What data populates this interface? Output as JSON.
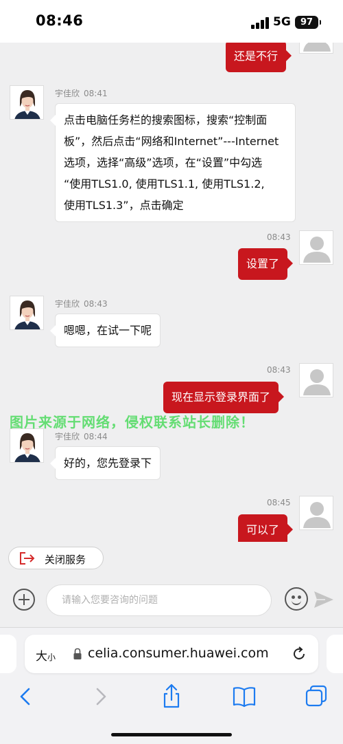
{
  "status_bar": {
    "time": "08:46",
    "network": "5G",
    "battery": "97"
  },
  "messages": [
    {
      "direction": "out",
      "text": "还是不行"
    },
    {
      "direction": "in",
      "sender": "宇佳欣",
      "time": "08:41",
      "lines": [
        "点击电脑任务栏的搜索图标，搜索“控制面",
        "板”，然后点击“网络和Internet”---Internet",
        "选项，选择“高级”选项，在“设置”中勾选",
        "“使用TLS1.0, 使用TLS1.1, 使用TLS1.2,",
        "使用TLS1.3”，点击确定"
      ]
    },
    {
      "direction": "out",
      "time": "08:43",
      "text": "设置了"
    },
    {
      "direction": "in",
      "sender": "宇佳欣",
      "time": "08:43",
      "text": "嗯嗯，在试一下呢"
    },
    {
      "direction": "out",
      "time": "08:43",
      "text": "现在显示登录界面了"
    },
    {
      "direction": "in",
      "sender": "宇佳欣",
      "time": "08:44",
      "text": "好的，您先登录下"
    },
    {
      "direction": "out",
      "time": "08:45",
      "text": "可以了"
    }
  ],
  "watermark": "图片来源于网络，侵权联系站长删除！",
  "close_service": {
    "label": "关闭服务"
  },
  "input": {
    "placeholder": "请输入您要咨询的问题"
  },
  "browser": {
    "text_size_label": "大",
    "text_size_small": "小",
    "url": "celia.consumer.huawei.com"
  },
  "icons": {
    "back": "chevron-left-icon",
    "forward": "chevron-right-icon",
    "share": "share-icon",
    "bookmarks": "book-icon",
    "tabs": "tabs-icon",
    "reload": "reload-icon",
    "lock": "lock-icon",
    "emoji": "smiley-icon",
    "send": "send-icon",
    "plus": "plus-icon",
    "exit": "exit-icon"
  },
  "colors": {
    "accent_red": "#c8171e",
    "ios_blue": "#1c7bf0",
    "watermark_green": "#3cd750"
  }
}
